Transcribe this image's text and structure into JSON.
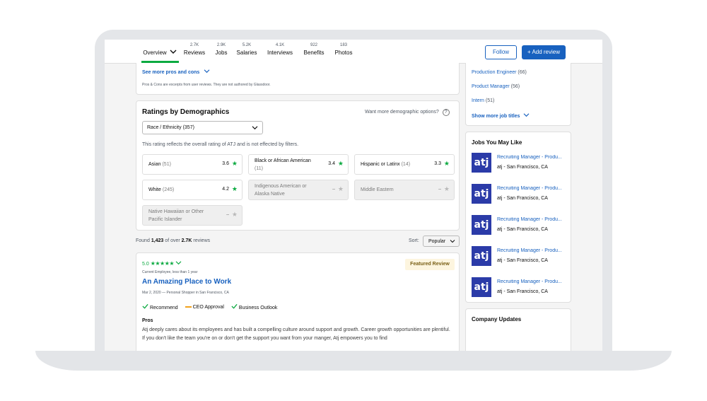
{
  "nav": {
    "tabs": [
      {
        "count": "",
        "label": "Overview"
      },
      {
        "count": "2.7K",
        "label": "Reviews"
      },
      {
        "count": "2.9K",
        "label": "Jobs"
      },
      {
        "count": "5.2K",
        "label": "Salaries"
      },
      {
        "count": "4.1K",
        "label": "Interviews"
      },
      {
        "count": "922",
        "label": "Benefits"
      },
      {
        "count": "183",
        "label": "Photos"
      }
    ],
    "follow_label": "Follow",
    "add_review_label": "+ Add review"
  },
  "pros_cons": {
    "see_more": "See more pros and cons",
    "disclaimer": "Pros & Cons are excerpts from user reviews. They are not authored by Glassdoor."
  },
  "demographics": {
    "title": "Ratings by Demographics",
    "more_options": "Want more demographic options?",
    "selector": "Race / Ethnicity (357)",
    "note": "This rating reflects the overall rating of ATJ and is not effected by filters.",
    "groups": [
      {
        "name": "Asian",
        "count": "(51)",
        "rating": "3.6",
        "star": "★"
      },
      {
        "name": "Black or African American",
        "count": "(11)",
        "rating": "3.4",
        "star": "★"
      },
      {
        "name": "Hispanic or Latinx",
        "count": "(14)",
        "rating": "3.3",
        "star": "★"
      },
      {
        "name": "White",
        "count": "(245)",
        "rating": "4.2",
        "star": "★"
      },
      {
        "name": "Indigenous American or Alaska Native",
        "count": "",
        "rating": "–",
        "star": "★"
      },
      {
        "name": "Middle Eastern",
        "count": "",
        "rating": "–",
        "star": "★"
      },
      {
        "name": "Native Hawaiian or Other Pacific Islander",
        "count": "",
        "rating": "–",
        "star": "★"
      }
    ]
  },
  "reviews_summary": {
    "prefix": "Found",
    "found": "1,423",
    "of_over": "of over",
    "total": "2.7K",
    "suffix": "reviews",
    "sort_label": "Sort:",
    "sort_value": "Popular"
  },
  "review": {
    "rating": "5.0",
    "stars": "★★★★★",
    "author_status": "Current Employee, less than 1 year",
    "featured_label": "Featured Review",
    "title": "An Amazing Place to Work",
    "meta": "Mar 2, 2020 — Personal Shopper in San Francisco, CA",
    "recommend": "Recommend",
    "ceo": "CEO Approval",
    "outlook": "Business Outlook",
    "pros_label": "Pros",
    "pros_text": "Atj deeply cares about its employees and has built a compelling culture around support and growth. Career growth opportunities are plentiful. If you don't like the team you're on or don't get the support you want from your manger, Atj empowers you to find"
  },
  "sidebar": {
    "job_titles": [
      {
        "title": "Production Engineer",
        "count": "(66)"
      },
      {
        "title": "Product Manager",
        "count": "(56)"
      },
      {
        "title": "Intern",
        "count": "(51)"
      }
    ],
    "show_more": "Show more job titles",
    "jobs_heading": "Jobs You May Like",
    "jobs": [
      {
        "logo": "atj",
        "title": "Recruiting Manager - Produ...",
        "location": "atj - San Francisco, CA"
      },
      {
        "logo": "atj",
        "title": "Recruiting Manager - Produ...",
        "location": "atj - San Francisco, CA"
      },
      {
        "logo": "atj",
        "title": "Recruiting Manager - Produ...",
        "location": "atj - San Francisco, CA"
      },
      {
        "logo": "atj",
        "title": "Recruiting Manager - Produ...",
        "location": "atj - San Francisco, CA"
      },
      {
        "logo": "atj",
        "title": "Recruiting Manager - Produ...",
        "location": "atj - San Francisco, CA"
      }
    ],
    "company_updates": "Company Updates"
  },
  "colors": {
    "brand_green": "#0caa41",
    "link_blue": "#1861bf",
    "logo_blue": "#2b3ba8"
  }
}
